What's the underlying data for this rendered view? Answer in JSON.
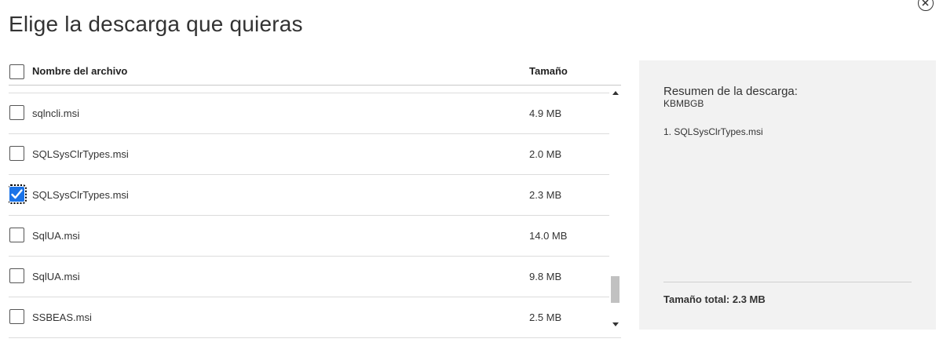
{
  "dialog": {
    "title": "Elige la descarga que quieras",
    "close_icon": "close-circle-icon"
  },
  "list": {
    "headers": {
      "name": "Nombre del archivo",
      "size": "Tamaño"
    },
    "rows": [
      {
        "name": "sqlncli.msi",
        "size": "4.9 MB",
        "checked": false
      },
      {
        "name": "SQLSysClrTypes.msi",
        "size": "2.0 MB",
        "checked": false
      },
      {
        "name": "SQLSysClrTypes.msi",
        "size": "2.3 MB",
        "checked": true
      },
      {
        "name": "SqlUA.msi",
        "size": "14.0 MB",
        "checked": false
      },
      {
        "name": "SqlUA.msi",
        "size": "9.8 MB",
        "checked": false
      },
      {
        "name": "SSBEAS.msi",
        "size": "2.5 MB",
        "checked": false
      }
    ],
    "accent_color": "#1a73e8"
  },
  "summary": {
    "title": "Resumen de la descarga:",
    "kb": "KBMBGB",
    "items": [
      "1. SQLSysClrTypes.msi"
    ],
    "total": "Tamaño total: 2.3 MB"
  }
}
